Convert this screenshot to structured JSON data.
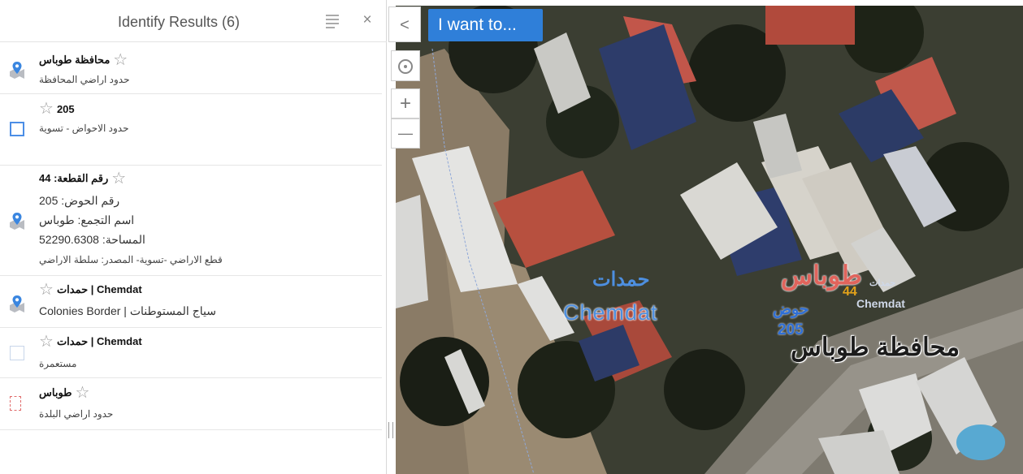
{
  "panel": {
    "title": "Identify Results (6)",
    "list_icon": "list-icon",
    "close_icon": "close-icon",
    "close_glyph": "×"
  },
  "results": [
    {
      "icon": "map-pin-icon",
      "title": "محافظة طوباس",
      "lines": [
        "حدود اراضي المحافظة"
      ]
    },
    {
      "icon": "blue-square-icon",
      "title": "205",
      "lines": [
        "حدود الاحواض - تسوية"
      ]
    },
    {
      "icon": "map-pin-icon",
      "title": "رقم القطعة: 44",
      "lines": [
        "رقم الحوض: 205",
        "اسم التجمع: طوباس",
        "المساحة: 52290.6308",
        "قطع الاراضي -تسوية- المصدر: سلطة الاراضي"
      ]
    },
    {
      "icon": "map-pin-icon",
      "title": "حمدات | Chemdat",
      "lines": [
        "Colonies Border  |  سياج المستوطنات"
      ]
    },
    {
      "icon": "light-square-icon",
      "title": "حمدات | Chemdat",
      "lines": [
        "مستعمرة"
      ]
    },
    {
      "icon": "red-dashed-square-icon",
      "title": "طوباس",
      "lines": [
        "حدود اراضي البلدة"
      ]
    }
  ],
  "map": {
    "i_want_to": "I want to...",
    "collapse_glyph": "<",
    "zoom_in": "+",
    "zoom_out": "—",
    "labels": {
      "hamdat_ar": "حمدات",
      "chemdat": "Chemdat",
      "tubas": "طوباس",
      "hawd": "حوض",
      "hawd_num": "205",
      "parcel_num": "44",
      "hamdat_small": "حمدات",
      "chemdat_small": "Chemdat",
      "governorate": "محافظة طوباس"
    },
    "colors": {
      "accent": "#2f7fd9",
      "label_blue": "#4d8fe0",
      "label_red": "#e0645c",
      "label_orange": "#e3a21a"
    }
  }
}
